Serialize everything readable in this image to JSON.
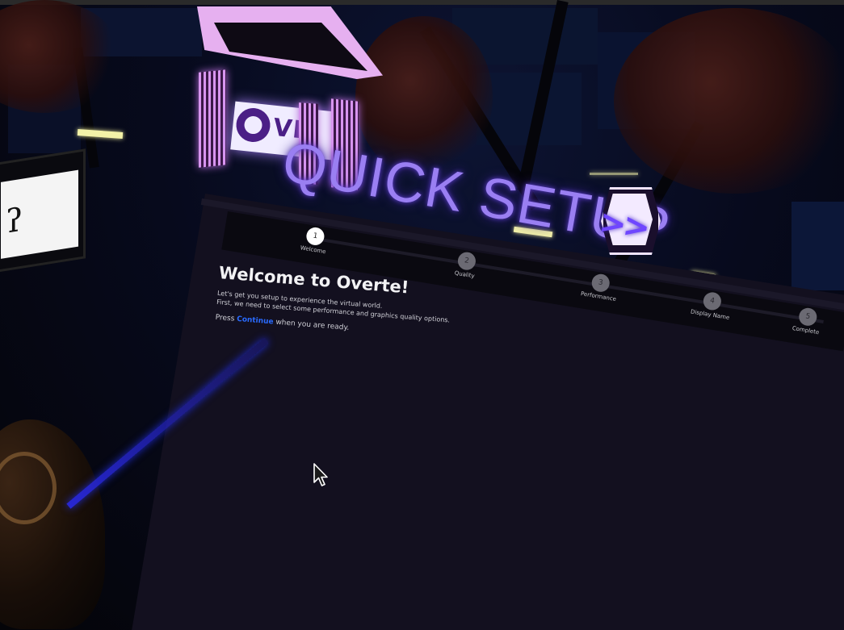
{
  "scene": {
    "sign_text": "QUICK SETUP",
    "logo_text": "VE",
    "next_badge_glyph": ">>"
  },
  "stepper": {
    "steps": [
      {
        "number": "1",
        "label": "Welcome",
        "active": true
      },
      {
        "number": "2",
        "label": "Quality",
        "active": false
      },
      {
        "number": "3",
        "label": "Performance",
        "active": false
      },
      {
        "number": "4",
        "label": "Display Name",
        "active": false
      },
      {
        "number": "5",
        "label": "Complete",
        "active": false
      }
    ]
  },
  "welcome": {
    "title": "Welcome to Overte!",
    "line1": "Let's get you setup to experience the virtual world.",
    "line2": "First, we need to select some performance and graphics quality options.",
    "press_prefix": "Press ",
    "continue_label": "Continue",
    "press_suffix": " when you are ready."
  },
  "colors": {
    "accent_purple": "#9a7ff2",
    "link_blue": "#2a6bff",
    "panel_bg": "#13101f",
    "laser_blue": "#2828dc"
  }
}
